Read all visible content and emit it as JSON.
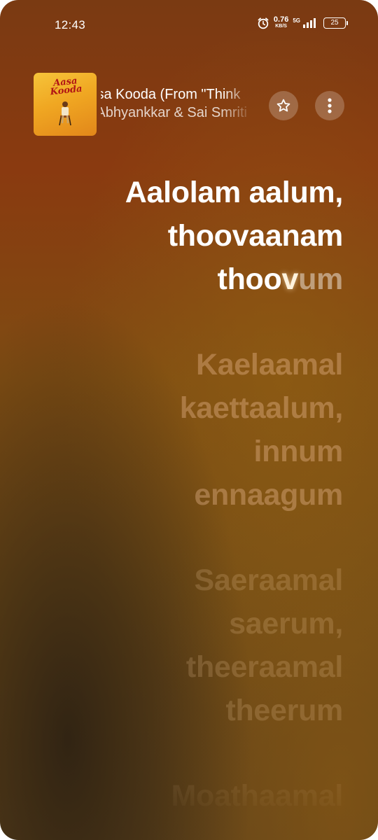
{
  "status_bar": {
    "time": "12:43",
    "net_speed_value": "0.76",
    "net_speed_unit": "KB/S",
    "network_type": "5G",
    "battery": "25",
    "icons": [
      "alarm-icon",
      "signal-icon",
      "battery-icon"
    ]
  },
  "now_playing": {
    "album_art_text": "Aasa Kooda",
    "title": "Aasa Kooda (From \"Think",
    "artist": "Sai Abhyankkar & Sai Smriti",
    "favorite_icon": "star-outline-icon",
    "more_icon": "more-vertical-icon"
  },
  "lyrics": {
    "active_lines": [
      "Aalolam aalum,",
      "thoovaanam"
    ],
    "active_partial": {
      "sung": "thoo",
      "current": "v",
      "unsung": "um"
    },
    "next_verse": [
      "Kaelaamal",
      "kaettaalum,",
      "innum",
      "ennaagum"
    ],
    "later_verse": [
      "Saeraamal",
      "saerum,",
      "theeraamal",
      "theerum"
    ],
    "last_line": "Moathaamal"
  },
  "colors": {
    "background_top": "#7a3a12",
    "background_bottom": "#62441a",
    "active_text": "#ffffff"
  }
}
